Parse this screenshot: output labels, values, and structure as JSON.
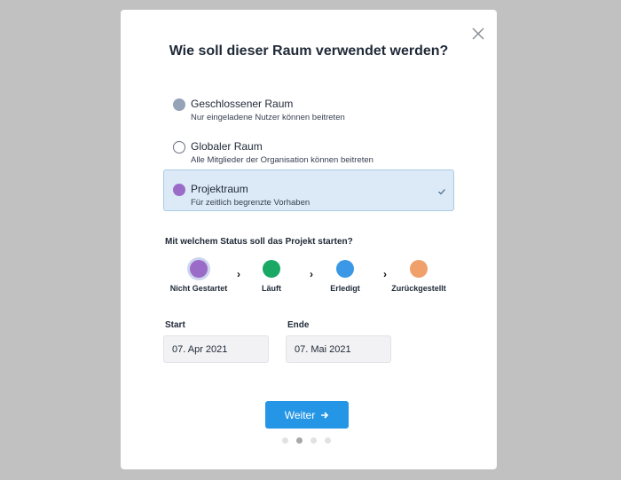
{
  "modal": {
    "title": "Wie soll dieser Raum verwendet werden?",
    "close_icon": "close-icon"
  },
  "room_types": [
    {
      "label": "Geschlossener Raum",
      "description": "Nur eingeladene Nutzer können beitreten",
      "color": "#94a3b8",
      "selected": false
    },
    {
      "label": "Globaler Raum",
      "description": "Alle Mitglieder der Organisation können beitreten",
      "color": "#ffffff",
      "selected": false
    },
    {
      "label": "Projektraum",
      "description": "Für zeitlich begrenzte Vorhaben",
      "color": "#9b6cc7",
      "selected": true
    }
  ],
  "status": {
    "question": "Mit welchem Status soll das Projekt starten?",
    "options": [
      {
        "label": "Nicht Gestartet",
        "color": "#9b6cc7",
        "active": true
      },
      {
        "label": "Läuft",
        "color": "#1aa865",
        "active": false
      },
      {
        "label": "Erledigt",
        "color": "#3a98e6",
        "active": false
      },
      {
        "label": "Zurückgestellt",
        "color": "#f0a06b",
        "active": false
      }
    ]
  },
  "dates": {
    "start_label": "Start",
    "start_value": "07. Apr 2021",
    "end_label": "Ende",
    "end_value": "07. Mai 2021"
  },
  "footer": {
    "next_label": "Weiter",
    "steps_total": 4,
    "step_current": 2
  },
  "colors": {
    "accent": "#2596e6",
    "selected_bg": "#dbeaf6",
    "overlay": "#c1c1c1"
  }
}
